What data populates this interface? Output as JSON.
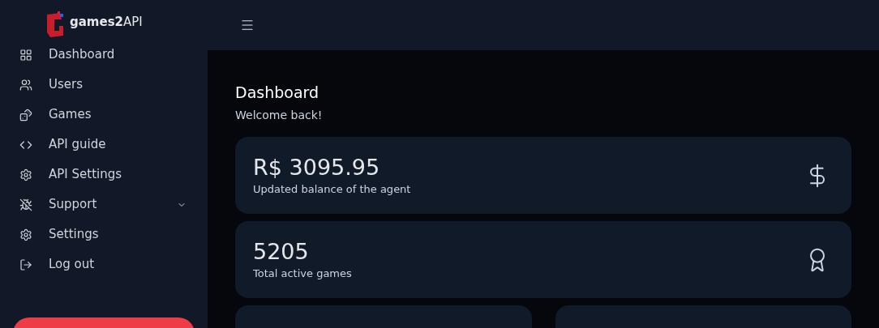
{
  "sidebar": {
    "logo": "**games2**API",
    "items": [
      {
        "label": "Dashboard",
        "selected": false
      },
      {
        "label": "Users",
        "selected": false
      },
      {
        "label": "Games",
        "selected": false
      },
      {
        "label": "API guide",
        "selected": false
      },
      {
        "label": "API Settings",
        "selected": false
      },
      {
        "label": "Support",
        "selected": false,
        "expanded": false
      },
      {
        "label": "Settings",
        "selected": false
      },
      {
        "label": "Log out",
        "selected": false
      }
    ]
  },
  "page": {
    "title": "Dashboard",
    "subtitle": "Welcome back!"
  },
  "stats": [
    {
      "value": "R$ 3095.95",
      "caption": "Updated balance of the agent"
    },
    {
      "value": "5205",
      "caption": "Total active games"
    }
  ]
}
